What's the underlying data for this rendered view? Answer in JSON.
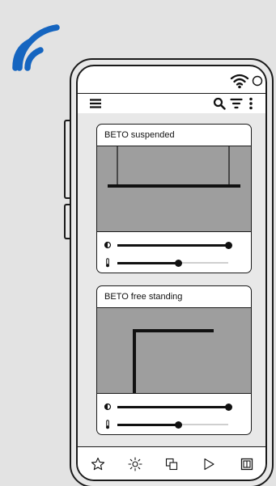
{
  "colors": {
    "signal_blue": "#1565c0",
    "preview_gray": "#9e9e9e",
    "outline": "#1a1a1a"
  },
  "icons": {
    "hero": "wifi-signal-icon",
    "status": [
      "wifi-icon",
      "circle-icon"
    ],
    "toolbar": [
      "hamburger-menu-icon",
      "search-icon",
      "filter-icon",
      "more-vertical-icon"
    ],
    "sliders": [
      "contrast-icon",
      "thermometer-icon"
    ],
    "bottom_nav": [
      "star-icon",
      "sun-icon",
      "layers-icon",
      "play-icon",
      "panel-icon"
    ]
  },
  "cards": [
    {
      "title": "BETO suspended",
      "sliders": [
        {
          "icon": "contrast-icon",
          "value": 1.0
        },
        {
          "icon": "thermometer-icon",
          "value": 0.55
        }
      ]
    },
    {
      "title": "BETO free standing",
      "sliders": [
        {
          "icon": "contrast-icon",
          "value": 1.0
        },
        {
          "icon": "thermometer-icon",
          "value": 0.55
        }
      ]
    }
  ]
}
